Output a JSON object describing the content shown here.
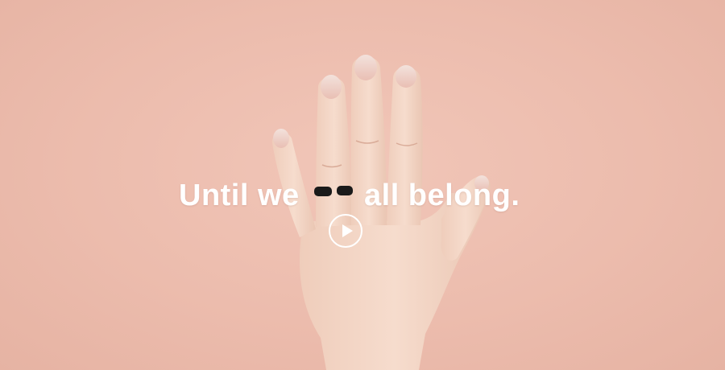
{
  "hero": {
    "headline_part1": "Until we",
    "headline_part2": "all belong.",
    "play_button_label": "Play video"
  },
  "colors": {
    "background": "#ecbcad",
    "skin": "#f2d3c2",
    "ring": "#1a1a1a",
    "text": "#ffffff"
  },
  "icons": {
    "play": "play-icon",
    "ring": "ring-icon"
  }
}
